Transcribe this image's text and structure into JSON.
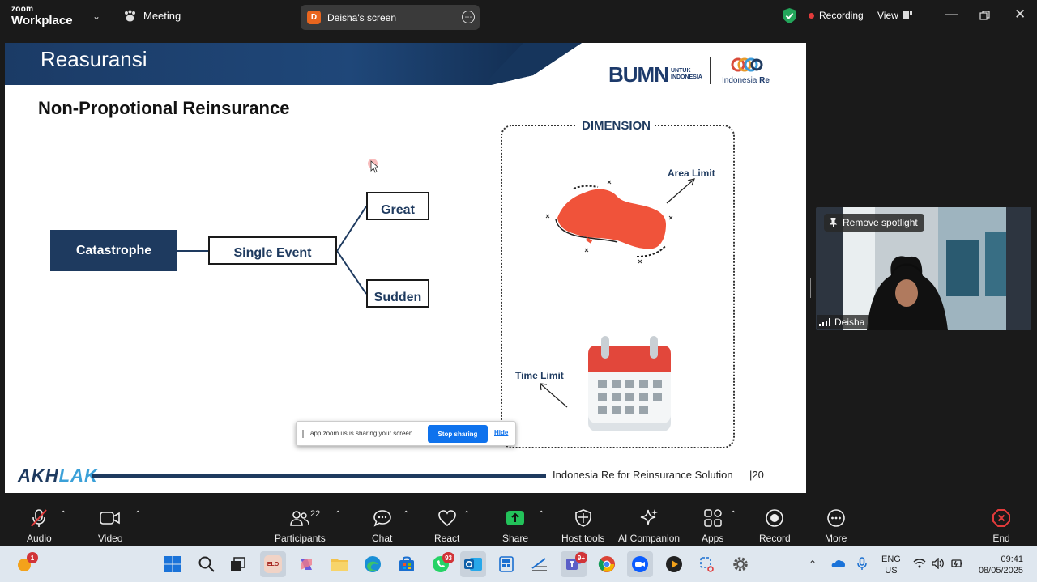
{
  "app": {
    "logo_small": "zoom",
    "logo_big": "Workplace",
    "meeting_label": "Meeting",
    "screen_owner_initial": "D",
    "screen_label": "Deisha's screen",
    "recording_label": "Recording",
    "view_label": "View",
    "colors": {
      "bg": "#1a1a1a",
      "record": "#e23b3b",
      "shield": "#23a55a",
      "accent": "#0e72ed"
    }
  },
  "slide": {
    "title": "Reasuransi",
    "bumn_big": "BUMN",
    "bumn_small_1": "UNTUK",
    "bumn_small_2": "INDONESIA",
    "partner_name_1": "Indonesia ",
    "partner_name_2": "Re",
    "heading": "Non-Propotional Reinsurance",
    "node_root": "Catastrophe",
    "node_mid": "Single Event",
    "node_top": "Great",
    "node_bottom": "Sudden",
    "dimension_title": "DIMENSION",
    "area_label": "Area Limit",
    "time_label": "Time Limit",
    "footer_left_1": "AKH",
    "footer_left_2": "LAK",
    "footer_text": "Indonesia Re for Reinsurance Solution",
    "page_number": "|20",
    "colors": {
      "navy": "#1e3a5f",
      "map": "#f0533a",
      "calendar_red": "#e2473b"
    }
  },
  "share_toast": {
    "message": "app.zoom.us is sharing your screen.",
    "stop_label": "Stop sharing",
    "hide_label": "Hide"
  },
  "participant": {
    "spotlight_label": "Remove spotlight",
    "name": "Deisha"
  },
  "toolbar": {
    "audio": "Audio",
    "video": "Video",
    "participants": "Participants",
    "participants_count": "22",
    "chat": "Chat",
    "react": "React",
    "share": "Share",
    "host_tools": "Host tools",
    "ai_companion": "AI Companion",
    "apps": "Apps",
    "record": "Record",
    "more": "More",
    "end": "End"
  },
  "taskbar": {
    "weather_badge": "1",
    "whatsapp_badge": "93",
    "teams_badge": "9+",
    "lang_1": "ENG",
    "lang_2": "US",
    "time": "09:41",
    "date": "08/05/2025"
  }
}
